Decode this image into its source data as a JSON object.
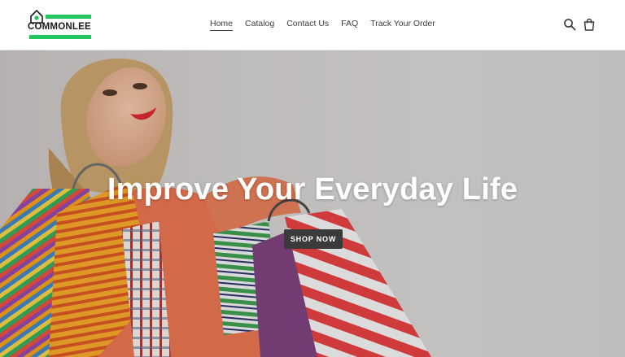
{
  "brand": {
    "name": "COMMONLEE",
    "accent_color": "#22c55e",
    "logo_icon": "house-icon"
  },
  "nav": {
    "items": [
      {
        "label": "Home",
        "active": true
      },
      {
        "label": "Catalog",
        "active": false
      },
      {
        "label": "Contact Us",
        "active": false
      },
      {
        "label": "FAQ",
        "active": false
      },
      {
        "label": "Track Your Order",
        "active": false
      }
    ]
  },
  "header_icons": {
    "search": "search-icon",
    "cart": "cart-icon"
  },
  "hero": {
    "heading": "Improve Your Everyday Life",
    "cta_label": "SHOP NOW",
    "cta_color": "#3a3a3a",
    "image": "woman-holding-shopping-bags"
  }
}
